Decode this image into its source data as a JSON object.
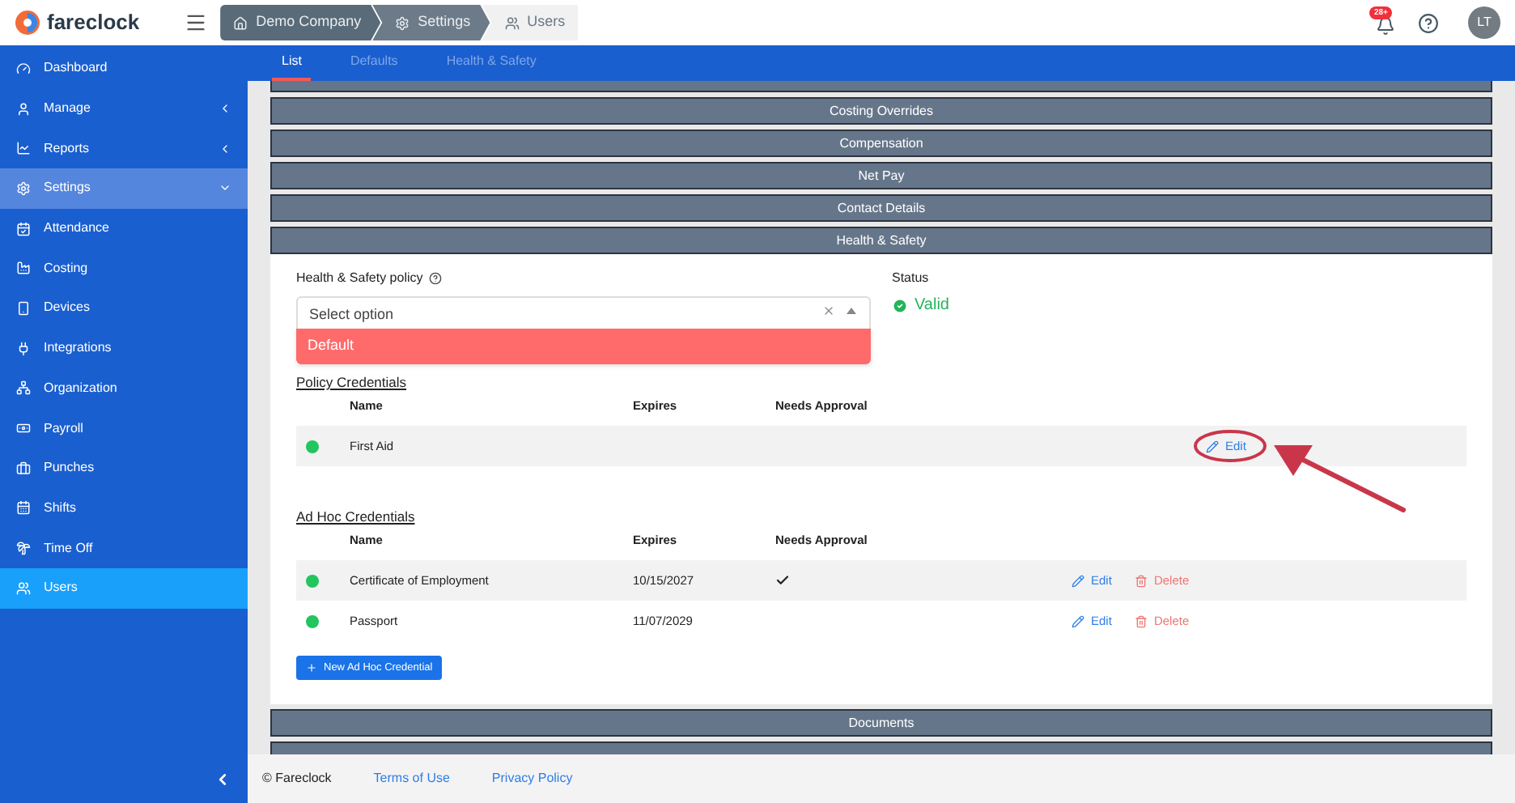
{
  "header": {
    "logo": "fareclock",
    "breadcrumbs": [
      {
        "label": "Demo Company",
        "current": false
      },
      {
        "label": "Settings",
        "current": false
      },
      {
        "label": "Users",
        "current": true
      }
    ],
    "notifications": "28+",
    "avatar": "LT"
  },
  "sidebar": {
    "items": [
      {
        "label": "Dashboard",
        "selected": false
      },
      {
        "label": "Manage",
        "selected": false,
        "expanded": false
      },
      {
        "label": "Reports",
        "selected": false,
        "expanded": false
      },
      {
        "label": "Settings",
        "selected": false,
        "expanded": true
      },
      {
        "label": "Attendance",
        "selected": false
      },
      {
        "label": "Costing",
        "selected": false
      },
      {
        "label": "Devices",
        "selected": false
      },
      {
        "label": "Integrations",
        "selected": false
      },
      {
        "label": "Organization",
        "selected": false
      },
      {
        "label": "Payroll",
        "selected": false
      },
      {
        "label": "Punches",
        "selected": false
      },
      {
        "label": "Shifts",
        "selected": false
      },
      {
        "label": "Time Off",
        "selected": false
      },
      {
        "label": "Users",
        "selected": true
      }
    ]
  },
  "tabs": [
    {
      "label": "List",
      "selected": true
    },
    {
      "label": "Defaults",
      "selected": false
    },
    {
      "label": "Health & Safety",
      "selected": false
    }
  ],
  "sections": [
    {
      "title": "Costing Overrides",
      "expanded": false
    },
    {
      "title": "Compensation",
      "expanded": false
    },
    {
      "title": "Net Pay",
      "expanded": false
    },
    {
      "title": "Contact Details",
      "expanded": false
    },
    {
      "title": "Health & Safety",
      "expanded": true
    },
    {
      "title": "Documents",
      "expanded": false
    }
  ],
  "health_safety": {
    "policy_label": "Health & Safety policy",
    "policy_select": {
      "placeholder": "Select option",
      "options": [
        {
          "label": "Default",
          "highlighted": true
        }
      ]
    },
    "status_label": "Status",
    "status": "Valid",
    "policy_credentials": {
      "title": "Policy Credentials",
      "columns": [
        "Name",
        "Expires",
        "Needs Approval"
      ],
      "rows": [
        {
          "name": "First Aid",
          "color": "#22c55e",
          "needs_approval": false,
          "actions": [
            {
              "kind": "edit",
              "label": "Edit",
              "circled": true
            }
          ]
        }
      ]
    },
    "ad_hoc_credentials": {
      "title": "Ad Hoc Credentials",
      "columns": [
        "Name",
        "Expires",
        "Needs Approval"
      ],
      "rows": [
        {
          "name": "Certificate of Employment",
          "expires": "10/15/2027",
          "color": "#22c55e",
          "needs_approval": true,
          "actions": [
            {
              "kind": "edit",
              "label": "Edit",
              "circled": false
            },
            {
              "kind": "delete",
              "label": "Delete",
              "circled": false
            }
          ]
        },
        {
          "name": "Passport",
          "expires": "11/07/2029",
          "color": "#22c55e",
          "needs_approval": false,
          "actions": [
            {
              "kind": "edit",
              "label": "Edit",
              "circled": false
            },
            {
              "kind": "delete",
              "label": "Delete",
              "circled": false
            }
          ]
        }
      ]
    },
    "new_button": "New Ad Hoc Credential"
  },
  "footer": {
    "copyright": "© Fareclock",
    "links": [
      "Terms of Use",
      "Privacy Policy"
    ]
  }
}
